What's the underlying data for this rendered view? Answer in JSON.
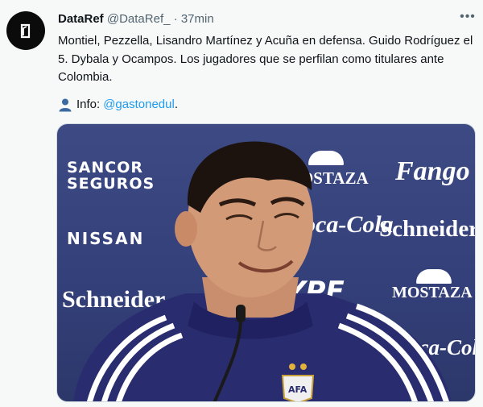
{
  "tweet": {
    "author_name": "DataRef",
    "author_handle": "@DataRef_",
    "separator": "·",
    "time": "37min",
    "more_icon": "more-horizontal-icon",
    "text": "Montiel, Pezzella, Lisandro Martínez y Acuña en defensa. Guido Rodríguez el 5. Dybala y Ocampos. Los jugadores que se perfilan como titulares ante Colombia.",
    "info_icon": "bust-in-silhouette-icon",
    "info_label": "Info:",
    "mention": "@gastonedul",
    "info_suffix": "."
  },
  "media": {
    "sponsor_logos": {
      "sancor_line1": "SANCOR",
      "sancor_line2": "SEGUROS",
      "nissan": "NISSAN",
      "schneider_1": "Schneider",
      "mostaza_1": "MOSTAZA",
      "fango": "Fango",
      "coca_cola_1": "Coca-Cola",
      "schneider_2": "Schneider",
      "ypf": "YPF",
      "mostaza_2": "MOSTAZA",
      "coca_cola_2": "Coca-Cola"
    },
    "jersey_badge": "AFA"
  },
  "colors": {
    "background": "#f7f9f9",
    "text": "#0f1419",
    "muted": "#536471",
    "link": "#1d9bf0",
    "backdrop_blue": "#3a4680"
  }
}
